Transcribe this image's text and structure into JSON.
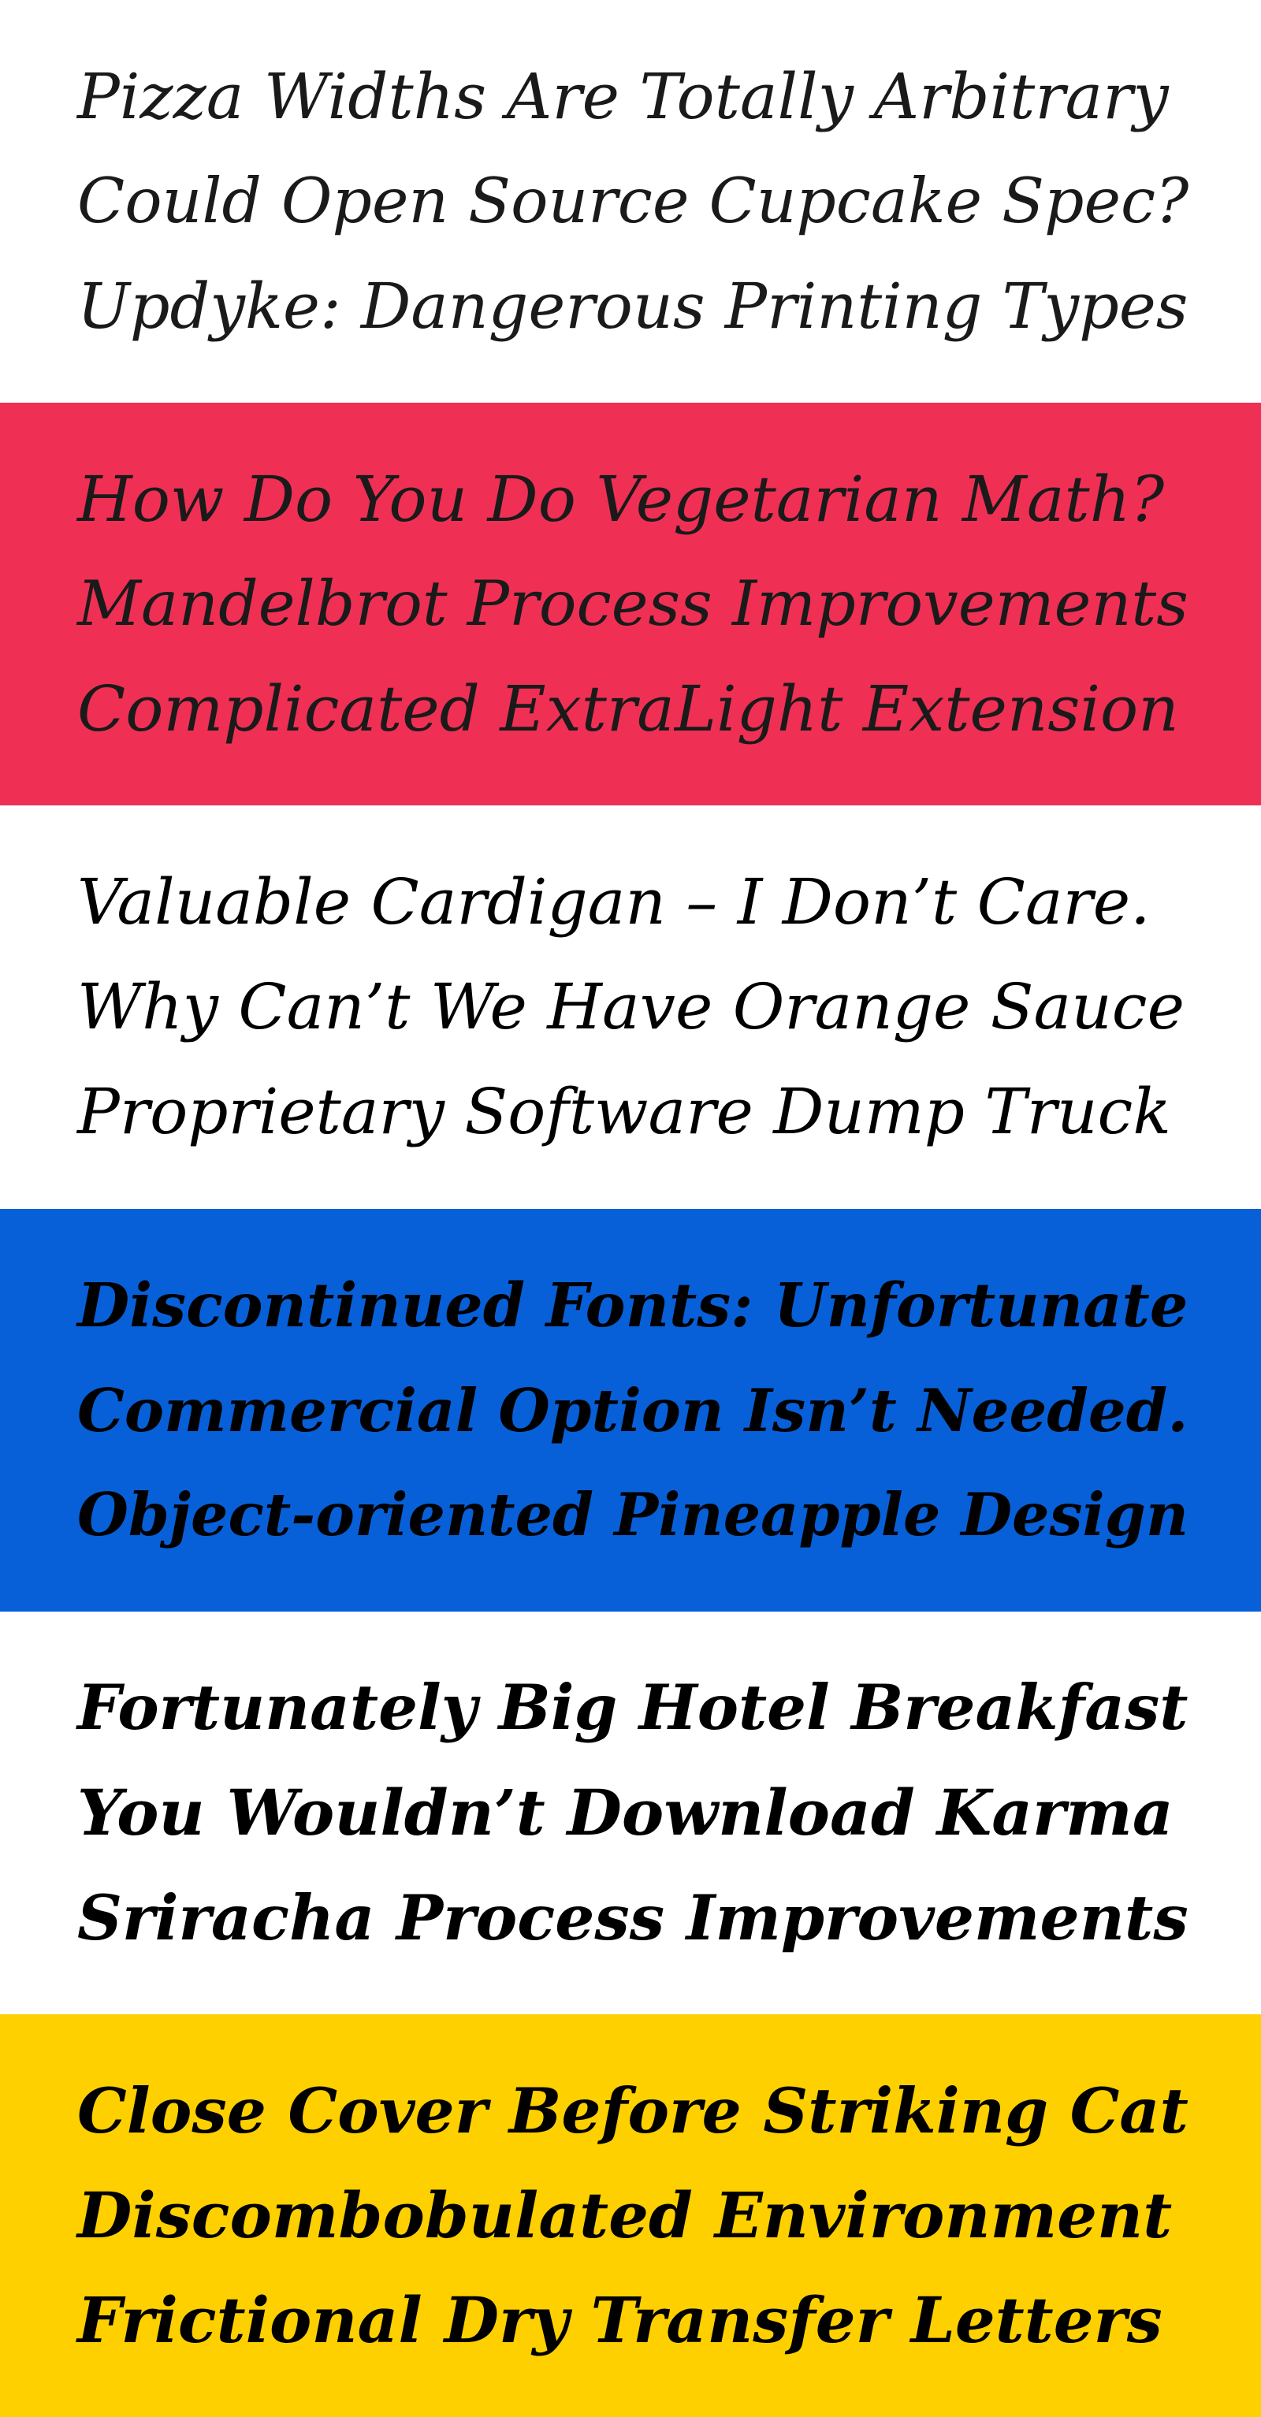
{
  "bands": [
    {
      "background": "#ffffff",
      "lines": [
        "Pizza Widths Are Totally Arbitrary",
        "Could Open Source Cupcake Spec?",
        "Updyke: Dangerous Printing Types"
      ]
    },
    {
      "background": "#ef3054",
      "lines": [
        "How Do You Do Vegetarian Math?",
        "Mandelbrot Process Improvements",
        "Complicated ExtraLight Extension"
      ]
    },
    {
      "background": "#ffffff",
      "lines": [
        "Valuable Cardigan – I Don’t Care.",
        "Why Can’t We Have Orange Sauce",
        "Proprietary Software Dump Truck"
      ]
    },
    {
      "background": "#0760d8",
      "lines": [
        "Discontinued Fonts: Unfortunate",
        "Commercial Option Isn’t Needed.",
        "Object-oriented Pineapple Design"
      ]
    },
    {
      "background": "#ffffff",
      "lines": [
        "Fortunately Big Hotel Breakfast",
        "You Wouldn’t Download Karma",
        "Sriracha Process Improvements"
      ]
    },
    {
      "background": "#ffd000",
      "lines": [
        "Close Cover Before Striking Cat",
        "Discombobulated Environment",
        "Frictional Dry Transfer Letters"
      ]
    }
  ]
}
